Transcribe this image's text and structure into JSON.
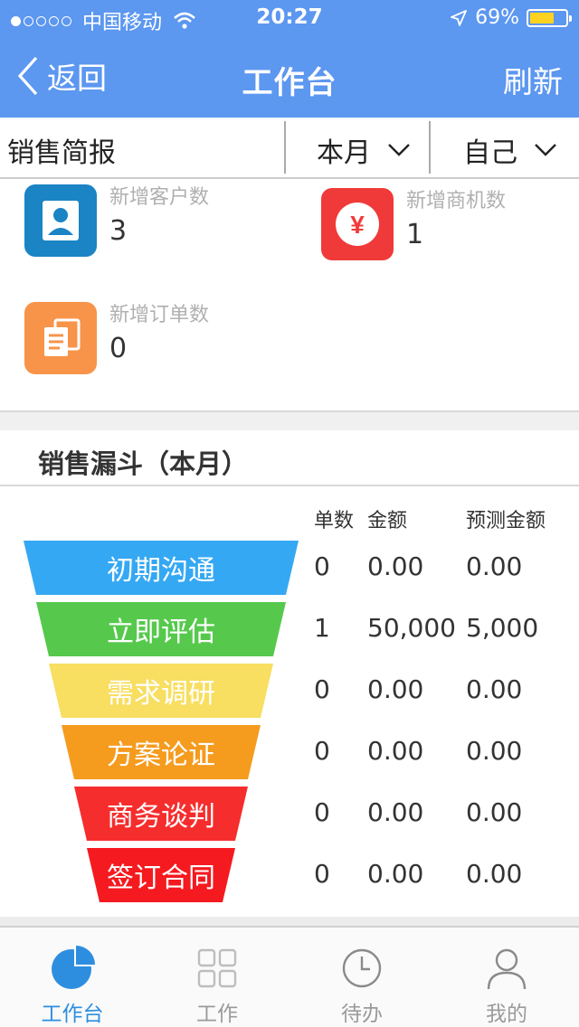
{
  "status_bar": {
    "carrier": "中国移动",
    "time": "20:27",
    "battery": "69%",
    "battery_level": 0.69
  },
  "nav": {
    "back_label": "返回",
    "title": "工作台",
    "refresh_label": "刷新"
  },
  "filter": {
    "title": "销售简报",
    "period": "本月",
    "owner": "自己"
  },
  "stats": {
    "new_customers": {
      "label": "新增客户数",
      "value": "3",
      "color": "#1a84c4"
    },
    "new_opportunities": {
      "label": "新增商机数",
      "value": "1",
      "color": "#f03a3a"
    },
    "new_orders": {
      "label": "新增订单数",
      "value": "0",
      "color": "#f7944a"
    }
  },
  "funnel": {
    "title": "销售漏斗（本月）",
    "columns": [
      "单数",
      "金额",
      "预测金额"
    ],
    "stages": [
      {
        "name": "初期沟通",
        "count": "0",
        "amount": "0.00",
        "forecast": "0.00",
        "color": "#35a8f3"
      },
      {
        "name": "立即评估",
        "count": "1",
        "amount": "50,000",
        "forecast": "5,000",
        "color": "#56c94d"
      },
      {
        "name": "需求调研",
        "count": "0",
        "amount": "0.00",
        "forecast": "0.00",
        "color": "#f8de61"
      },
      {
        "name": "方案论证",
        "count": "0",
        "amount": "0.00",
        "forecast": "0.00",
        "color": "#f59b1e"
      },
      {
        "name": "商务谈判",
        "count": "0",
        "amount": "0.00",
        "forecast": "0.00",
        "color": "#f62d2d"
      },
      {
        "name": "签订合同",
        "count": "0",
        "amount": "0.00",
        "forecast": "0.00",
        "color": "#f41a1f"
      }
    ]
  },
  "tabs": [
    {
      "label": "工作台",
      "icon": "pie-chart-icon",
      "active": true
    },
    {
      "label": "工作",
      "icon": "grid-icon",
      "active": false
    },
    {
      "label": "待办",
      "icon": "clock-icon",
      "active": false
    },
    {
      "label": "我的",
      "icon": "person-icon",
      "active": false
    }
  ]
}
